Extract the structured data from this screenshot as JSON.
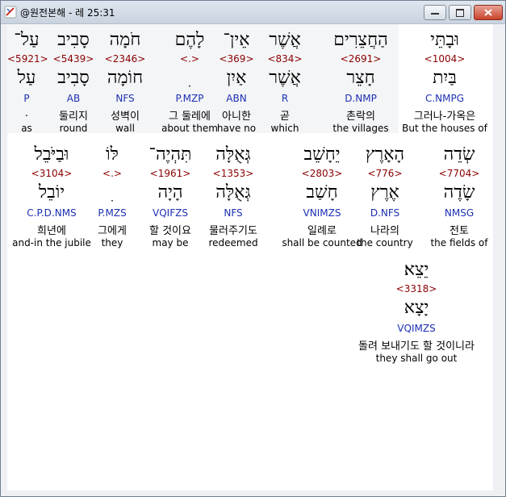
{
  "window": {
    "title": "@원전본해 - 레 25:31",
    "controls": {
      "minimize": "–",
      "maximize": "▭",
      "close": "✕"
    }
  },
  "rows": [
    [
      {
        "heb": "וּבָתֵּי",
        "strong": "<1004>",
        "lemma": "בַּיִת",
        "morph": "C.NMPG",
        "kor": "그러나-가옥은",
        "eng": "But the houses of",
        "hl": true
      },
      {
        "heb": "הַחֲצֵרִים",
        "strong": "<2691>",
        "lemma": "חָצֵר",
        "morph": "D.NMP",
        "kor": "촌락의",
        "eng": "the villages"
      },
      {
        "heb": "אֲשֶׁר",
        "strong": "<834>",
        "lemma": "אֲשֶׁר",
        "morph": "R",
        "kor": "곧",
        "eng": "which"
      },
      {
        "heb": "אֵין־",
        "strong": "<369>",
        "lemma": "אַיִן",
        "morph": "ABN",
        "kor": "아니한",
        "eng": "have no"
      },
      {
        "heb": "לָהֶם",
        "strong": "<.>",
        "lemma": "ׅ",
        "morph": "P.MZP",
        "kor": "그 둘레에",
        "eng": "about them"
      },
      {
        "heb": "חֹמָה",
        "strong": "<2346>",
        "lemma": "חוֹמָה",
        "morph": "NFS",
        "kor": "성벽이",
        "eng": "wall"
      },
      {
        "heb": "סָבִיב",
        "strong": "<5439>",
        "lemma": "סָבִיב",
        "morph": "AB",
        "kor": "둘리지",
        "eng": "round"
      },
      {
        "heb": "עַל־",
        "strong": "<5921>",
        "lemma": "עַל",
        "morph": "P",
        "kor": ".",
        "eng": "as"
      }
    ],
    [
      {
        "heb": "שְׂדֵה",
        "strong": "<7704>",
        "lemma": "שָׂדֶה",
        "morph": "NMSG",
        "kor": "전토",
        "eng": "the fields of"
      },
      {
        "heb": "הָאָרֶץ",
        "strong": "<776>",
        "lemma": "אֶרֶץ",
        "morph": "D.NFS",
        "kor": "나라의",
        "eng": "the country"
      },
      {
        "heb": "יֵחָשֵׁב",
        "strong": "<2803>",
        "lemma": "חָשַׁב",
        "morph": "VNIMZS",
        "kor": "일례로",
        "eng": "shall be counted"
      },
      {
        "heb": "גְּאֻלָּה",
        "strong": "<1353>",
        "lemma": "גְּאֻלָּה",
        "morph": "NFS",
        "kor": "물러주기도",
        "eng": "redeemed"
      },
      {
        "heb": "תִּהְיֶה־",
        "strong": "<1961>",
        "lemma": "הָיָה",
        "morph": "VQIFZS",
        "kor": "할 것이요",
        "eng": "may be"
      },
      {
        "heb": "לּוֹ",
        "strong": "<.>",
        "lemma": "ׅ",
        "morph": "P.MZS",
        "kor": "그에게",
        "eng": "they"
      },
      {
        "heb": "וּבַיֹּבֵל",
        "strong": "<3104>",
        "lemma": "יוֹבֵל",
        "morph": "C.P.D.NMS",
        "kor": "희년에",
        "eng": "and-in the jubile"
      }
    ],
    [
      {
        "heb": "יֵצֵא׃",
        "strong": "<3318>",
        "lemma": "יָצָא",
        "morph": "VQIMZS",
        "kor": "돌려 보내기도 할 것이니라",
        "eng": "they shall go out"
      }
    ]
  ]
}
